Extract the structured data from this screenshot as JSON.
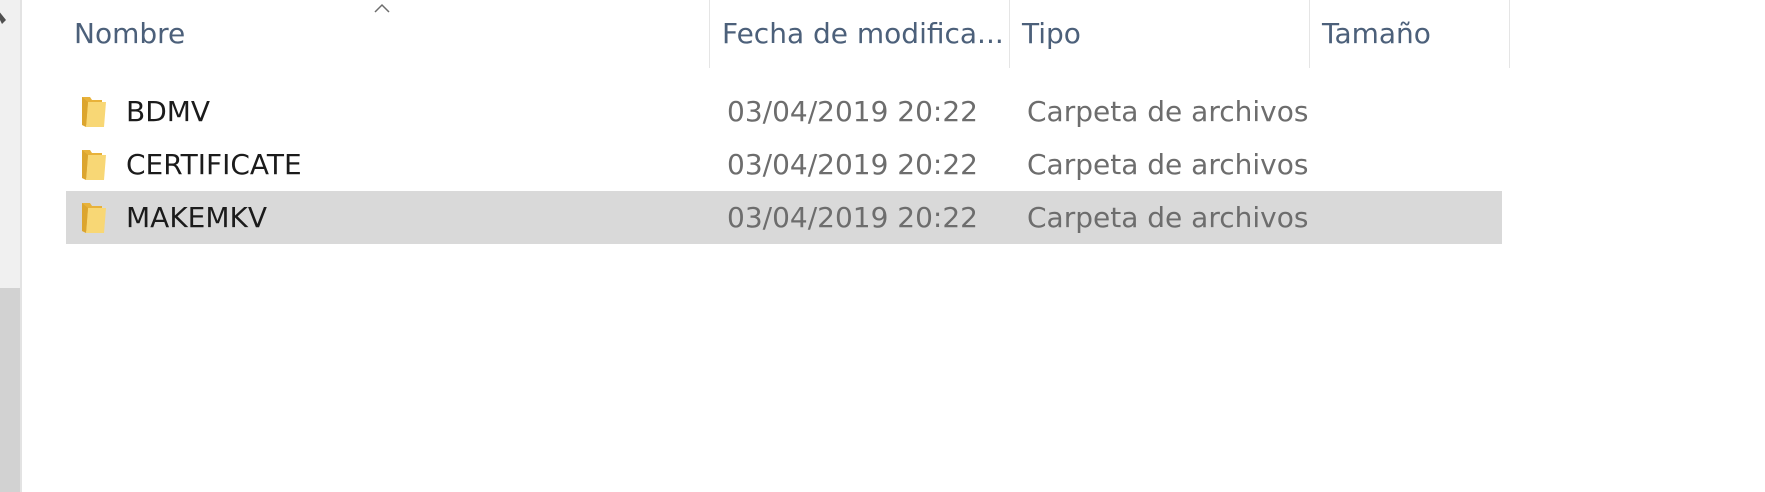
{
  "columns": {
    "name": "Nombre",
    "date": "Fecha de modifica...",
    "type": "Tipo",
    "size": "Tamaño"
  },
  "files": [
    {
      "name": "BDMV",
      "date": "03/04/2019 20:22",
      "type": "Carpeta de archivos",
      "size": "",
      "selected": false
    },
    {
      "name": "CERTIFICATE",
      "date": "03/04/2019 20:22",
      "type": "Carpeta de archivos",
      "size": "",
      "selected": false
    },
    {
      "name": "MAKEMKV",
      "date": "03/04/2019 20:22",
      "type": "Carpeta de archivos",
      "size": "",
      "selected": true
    }
  ],
  "icons": {
    "folder": "folder-icon",
    "sort": "sort-ascending-icon"
  },
  "colors": {
    "header_text": "#4c607a",
    "selection": "#d9d9d9",
    "folder": "#f5c64b"
  }
}
